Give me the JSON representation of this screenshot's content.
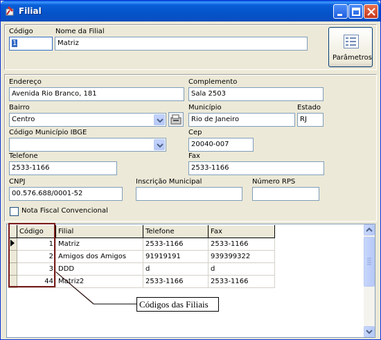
{
  "window": {
    "title": "Filial",
    "icon": "app-icon"
  },
  "header": {
    "codigo_label": "Código",
    "codigo_value": "1",
    "nome_label": "Nome da Filial",
    "nome_value": "Matriz",
    "parametros_label": "Parâmetros"
  },
  "address": {
    "endereco_label": "Endereço",
    "endereco_value": "Avenida Rio Branco, 181",
    "complemento_label": "Complemento",
    "complemento_value": "Sala 2503",
    "bairro_label": "Bairro",
    "bairro_value": "Centro",
    "municipio_label": "Município",
    "municipio_value": "Rio de Janeiro",
    "estado_label": "Estado",
    "estado_value": "RJ",
    "ibge_label": "Código Município IBGE",
    "ibge_value": "",
    "cep_label": "Cep",
    "cep_value": "20040-007",
    "telefone_label": "Telefone",
    "telefone_value": "2533-1166",
    "fax_label": "Fax",
    "fax_value": "2533-1166",
    "cnpj_label": "CNPJ",
    "cnpj_value": "00.576.688/0001-52",
    "inscricao_label": "Inscrição Municipal",
    "inscricao_value": "",
    "rps_label": "Número RPS",
    "rps_value": "",
    "nota_fiscal_label": "Nota Fiscal Convencional",
    "nota_fiscal_checked": false
  },
  "grid": {
    "columns": [
      "Código",
      "Filial",
      "Telefone",
      "Fax"
    ],
    "rows": [
      {
        "codigo": "1",
        "filial": "Matriz",
        "telefone": "2533-1166",
        "fax": "2533-1166",
        "current": true
      },
      {
        "codigo": "2",
        "filial": "Amigos dos Amigos",
        "telefone": "91919191",
        "fax": "939399322",
        "current": false
      },
      {
        "codigo": "3",
        "filial": "DDD",
        "telefone": "d",
        "fax": "d",
        "current": false
      },
      {
        "codigo": "44",
        "filial": "Matriz2",
        "telefone": "2533-1166",
        "fax": "2533-1166",
        "current": false
      }
    ]
  },
  "annotation": {
    "text": "Códigos das Filiais",
    "color": "#7a1a1a"
  }
}
